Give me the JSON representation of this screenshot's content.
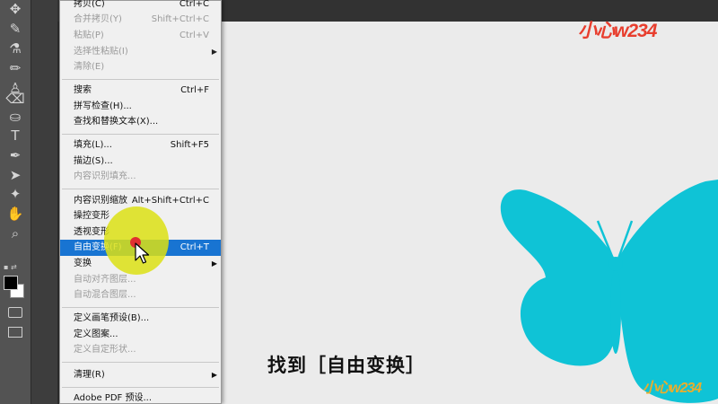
{
  "menu": {
    "items": [
      {
        "label": "拷贝(C)",
        "shortcut": "Ctrl+C",
        "disabled": false
      },
      {
        "label": "合并拷贝(Y)",
        "shortcut": "Shift+Ctrl+C",
        "disabled": true
      },
      {
        "label": "粘贴(P)",
        "shortcut": "Ctrl+V",
        "disabled": true
      },
      {
        "label": "选择性粘贴(I)",
        "shortcut": "",
        "disabled": true,
        "submenu": true
      },
      {
        "label": "清除(E)",
        "shortcut": "",
        "disabled": true
      },
      {
        "label": "搜索",
        "shortcut": "Ctrl+F",
        "disabled": false
      },
      {
        "label": "拼写检查(H)...",
        "shortcut": "",
        "disabled": false
      },
      {
        "label": "查找和替换文本(X)...",
        "shortcut": "",
        "disabled": false
      },
      {
        "label": "填充(L)...",
        "shortcut": "Shift+F5",
        "disabled": false
      },
      {
        "label": "描边(S)...",
        "shortcut": "",
        "disabled": false
      },
      {
        "label": "内容识别填充...",
        "shortcut": "",
        "disabled": true
      },
      {
        "label": "内容识别缩放",
        "shortcut": "Alt+Shift+Ctrl+C",
        "disabled": false
      },
      {
        "label": "操控变形",
        "shortcut": "",
        "disabled": false
      },
      {
        "label": "透视变形",
        "shortcut": "",
        "disabled": false
      },
      {
        "label": "自由变换(F)",
        "shortcut": "Ctrl+T",
        "disabled": false,
        "selected": true
      },
      {
        "label": "变换",
        "shortcut": "",
        "disabled": false,
        "submenu": true
      },
      {
        "label": "自动对齐图层...",
        "shortcut": "",
        "disabled": true
      },
      {
        "label": "自动混合图层...",
        "shortcut": "",
        "disabled": true
      },
      {
        "label": "定义画笔预设(B)...",
        "shortcut": "",
        "disabled": false
      },
      {
        "label": "定义图案...",
        "shortcut": "",
        "disabled": false
      },
      {
        "label": "定义自定形状...",
        "shortcut": "",
        "disabled": true
      },
      {
        "label": "清理(R)",
        "shortcut": "",
        "disabled": false,
        "submenu": true
      },
      {
        "label": "Adobe PDF 预设...",
        "shortcut": "",
        "disabled": false
      }
    ]
  },
  "subtitle": "找到［自由变换］",
  "watermark": "小心w234",
  "colors": {
    "butterfly": "#0fc3d6",
    "selection": "#1874d2",
    "highlight": "#dce014"
  },
  "tools": [
    {
      "icon": "move-icon",
      "glyph": "✥"
    },
    {
      "icon": "brush-icon",
      "glyph": "✎"
    },
    {
      "icon": "eyedropper-icon",
      "glyph": "⚗"
    },
    {
      "icon": "pencil-icon",
      "glyph": "✏"
    },
    {
      "icon": "stamp-icon",
      "glyph": "♙"
    },
    {
      "icon": "eraser-icon",
      "glyph": "⌫"
    },
    {
      "icon": "bucket-icon",
      "glyph": "⛀"
    },
    {
      "icon": "type-icon",
      "glyph": "T"
    },
    {
      "icon": "pen-icon",
      "glyph": "✒"
    },
    {
      "icon": "path-select-icon",
      "glyph": "➤"
    },
    {
      "icon": "shape-icon",
      "glyph": "✦"
    },
    {
      "icon": "hand-icon",
      "glyph": "✋"
    },
    {
      "icon": "zoom-icon",
      "glyph": "⌕"
    }
  ]
}
